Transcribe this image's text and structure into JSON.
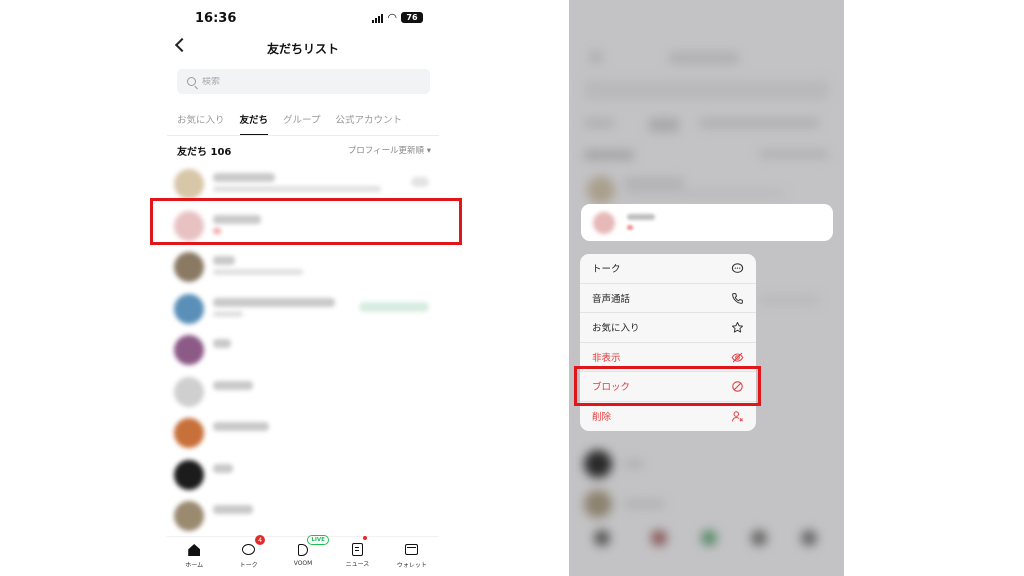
{
  "status_bar": {
    "time": "16:36",
    "battery": "76",
    "icons": [
      "signal-icon",
      "wifi-icon",
      "battery-icon"
    ]
  },
  "header": {
    "title": "友だちリスト",
    "back_icon": "chevron-left-icon"
  },
  "search": {
    "placeholder": "検索"
  },
  "tabs": [
    {
      "label": "お気に入り",
      "active": false
    },
    {
      "label": "友だち",
      "active": true
    },
    {
      "label": "グループ",
      "active": false
    },
    {
      "label": "公式アカウント",
      "active": false
    }
  ],
  "section": {
    "count_label": "友だち 106",
    "sort_label": "プロフィール更新順 ▾"
  },
  "bottom_nav": [
    {
      "label": "ホーム",
      "icon": "home-icon"
    },
    {
      "label": "トーク",
      "icon": "chat-icon",
      "badge": "4"
    },
    {
      "label": "VOOM",
      "icon": "voom-icon",
      "badge": "LIVE"
    },
    {
      "label": "ニュース",
      "icon": "news-icon"
    },
    {
      "label": "ウォレット",
      "icon": "wallet-icon"
    }
  ],
  "context_menu": {
    "items": [
      {
        "label": "トーク",
        "icon": "chat-icon",
        "danger": false
      },
      {
        "label": "音声通話",
        "icon": "phone-icon",
        "danger": false
      },
      {
        "label": "お気に入り",
        "icon": "star-icon",
        "danger": false
      },
      {
        "label": "非表示",
        "icon": "eye-off-icon",
        "danger": true
      },
      {
        "label": "ブロック",
        "icon": "block-icon",
        "danger": true
      },
      {
        "label": "削除",
        "icon": "user-remove-icon",
        "danger": true
      }
    ]
  },
  "colors": {
    "highlight": "#e0161b",
    "danger": "#e23b3b",
    "badge": "#e52a2a",
    "live": "#1dbf52"
  }
}
